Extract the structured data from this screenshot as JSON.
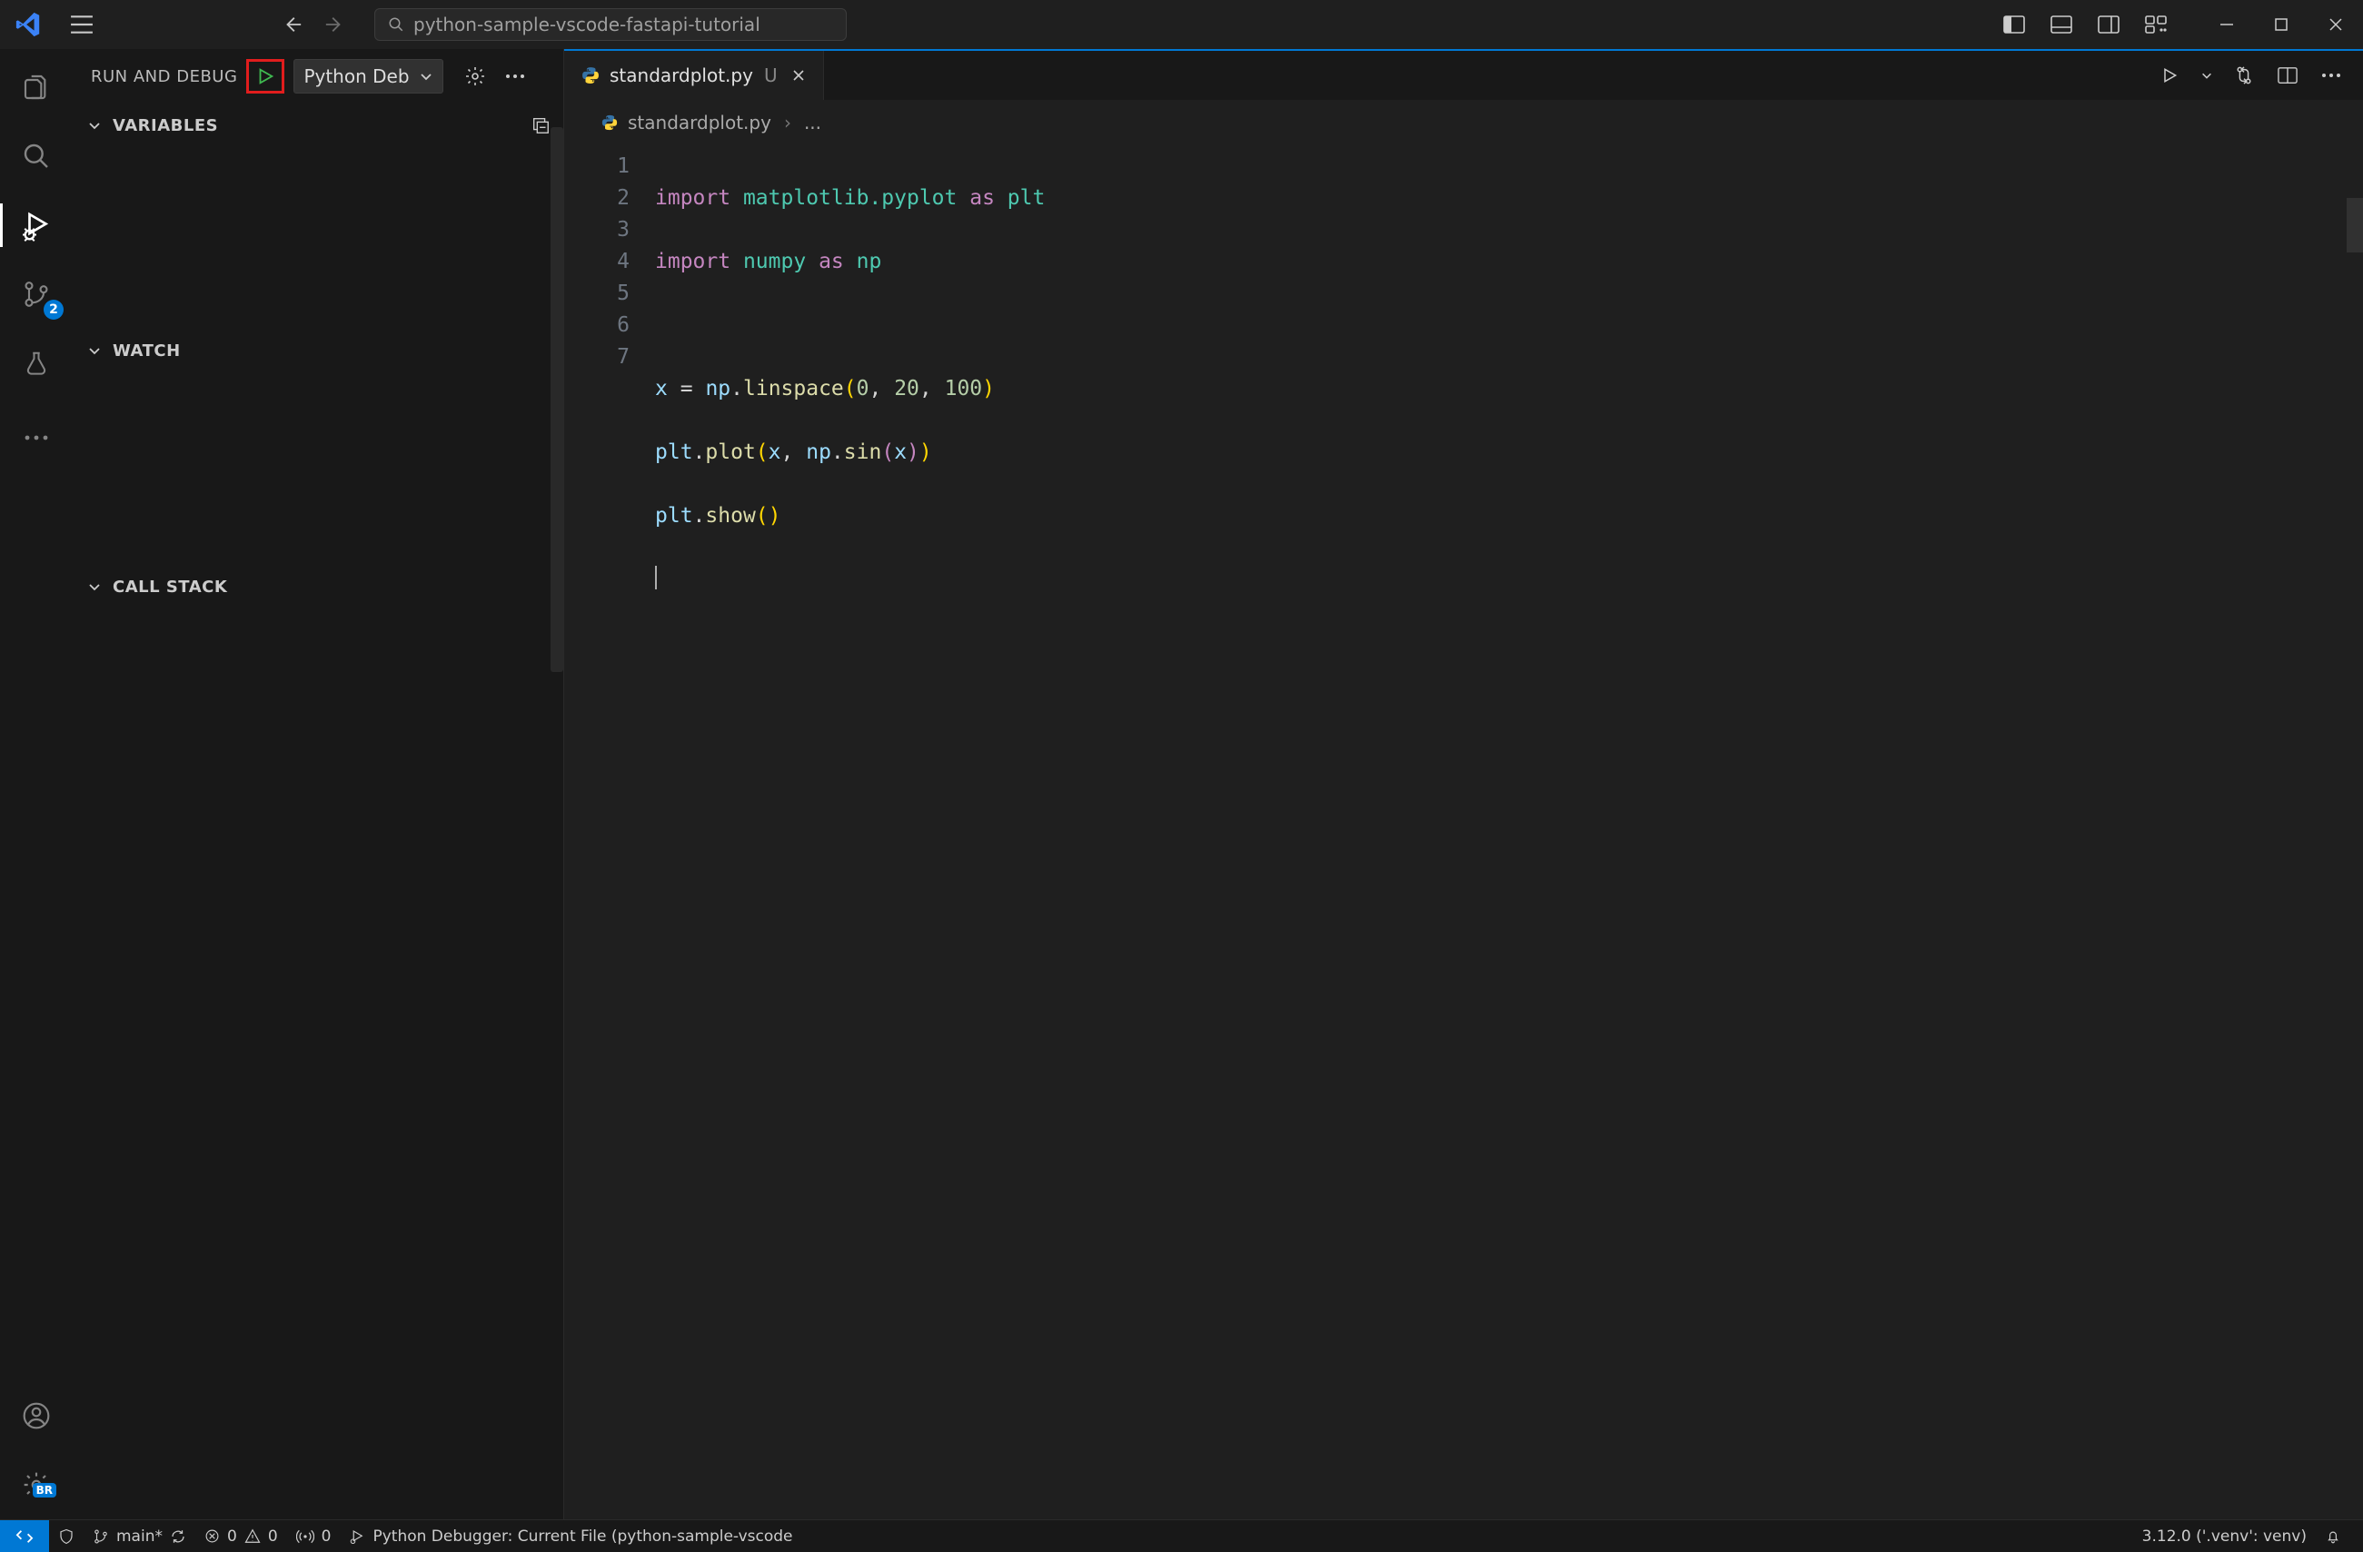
{
  "titlebar": {
    "search_placeholder": "python-sample-vscode-fastapi-tutorial"
  },
  "debug": {
    "panel_title": "RUN AND DEBUG",
    "config_selected": "Python Deb",
    "sections": {
      "variables": "VARIABLES",
      "watch": "WATCH",
      "callstack": "CALL STACK"
    }
  },
  "activity": {
    "scm_badge": "2",
    "settings_badge": "BR"
  },
  "tab": {
    "file": "standardplot.py",
    "modified_marker": "U"
  },
  "breadcrumb": {
    "file": "standardplot.py",
    "tail": "..."
  },
  "code": {
    "lines": [
      "1",
      "2",
      "3",
      "4",
      "5",
      "6",
      "7"
    ],
    "l1": {
      "kw": "import",
      "mod": "matplotlib.pyplot",
      "as": "as",
      "alias": "plt"
    },
    "l2": {
      "kw": "import",
      "mod": "numpy",
      "as": "as",
      "alias": "np"
    },
    "l4": {
      "var": "x",
      "eq": "=",
      "obj": "np",
      "fn": "linspace",
      "a": "0",
      "b": "20",
      "c": "100"
    },
    "l5": {
      "obj": "plt",
      "fn": "plot",
      "arg1": "x",
      "obj2": "np",
      "fn2": "sin",
      "arg2": "x"
    },
    "l6": {
      "obj": "plt",
      "fn": "show"
    }
  },
  "status": {
    "branch": "main*",
    "errors": "0",
    "warnings": "0",
    "ports": "0",
    "debug_target": "Python Debugger: Current File (python-sample-vscode",
    "python_version": "3.12.0 ('.venv': venv)"
  }
}
